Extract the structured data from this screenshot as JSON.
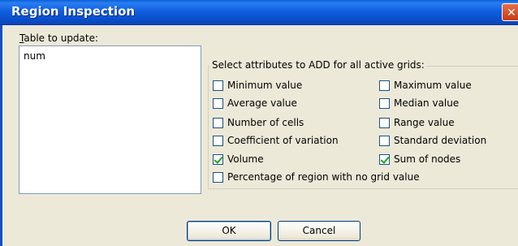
{
  "window": {
    "title": "Region Inspection"
  },
  "table_section": {
    "label_prefix": "",
    "label_mnemonic": "T",
    "label_rest": "able to update:",
    "items": [
      "num"
    ]
  },
  "attributes": {
    "group_label": "Select attributes to ADD for all active grids:",
    "options": [
      {
        "label": "Minimum value",
        "checked": false
      },
      {
        "label": "Maximum value",
        "checked": false
      },
      {
        "label": "Average value",
        "checked": false
      },
      {
        "label": "Median value",
        "checked": false
      },
      {
        "label": "Number of cells",
        "checked": false
      },
      {
        "label": "Range value",
        "checked": false
      },
      {
        "label": "Coefficient of variation",
        "checked": false
      },
      {
        "label": "Standard deviation",
        "checked": false
      },
      {
        "label": "Volume",
        "checked": true
      },
      {
        "label": "Sum of nodes",
        "checked": true
      },
      {
        "label": "Percentage of region with no grid value",
        "checked": false
      }
    ]
  },
  "buttons": {
    "ok": "OK",
    "cancel": "Cancel"
  },
  "colors": {
    "title_bar": "#0a5fd8",
    "face": "#ece9d8",
    "check": "#21a121"
  }
}
